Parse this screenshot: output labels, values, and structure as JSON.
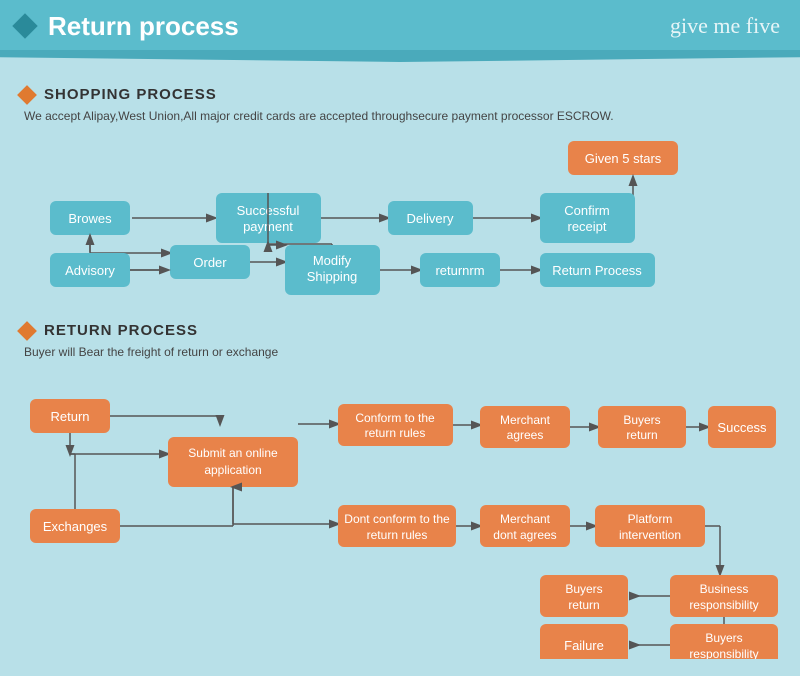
{
  "header": {
    "title": "Return process",
    "logo": "give me five",
    "diamond_color": "#2a8a9a"
  },
  "shopping_section": {
    "title": "SHOPPING PROCESS",
    "description": "We accept Alipay,West Union,All major credit cards are accepted throughsecure payment processor ESCROW."
  },
  "return_section": {
    "title": "RETURN PROCESS",
    "description": "Buyer will Bear the freight of return or exchange"
  },
  "shopping_nodes": {
    "browes": "Browes",
    "order": "Order",
    "advisory": "Advisory",
    "modify_shipping": "Modify\nShipping",
    "successful_payment": "Successful\npayment",
    "delivery": "Delivery",
    "confirm_receipt": "Confirm\nreceipt",
    "given_5_stars": "Given 5 stars",
    "returnrm": "returnrm",
    "return_process": "Return Process"
  },
  "return_nodes": {
    "return": "Return",
    "exchanges": "Exchanges",
    "submit_online": "Submit an online\napplication",
    "conform_rules": "Conform to the\nreturn rules",
    "dont_conform_rules": "Dont conform to the\nreturn rules",
    "merchant_agrees": "Merchant\nagrees",
    "merchant_dont_agrees": "Merchant\ndont agrees",
    "buyers_return_1": "Buyers\nreturn",
    "buyers_return_2": "Buyers\nreturn",
    "platform_intervention": "Platform\nintervention",
    "success": "Success",
    "business_responsibility": "Business\nresponsibility",
    "buyers_responsibility": "Buyers\nresponsibility",
    "failure": "Failure"
  },
  "colors": {
    "teal": "#5bbccc",
    "orange": "#e8834a",
    "arrow": "#555555",
    "bg": "#b8e0e8"
  }
}
